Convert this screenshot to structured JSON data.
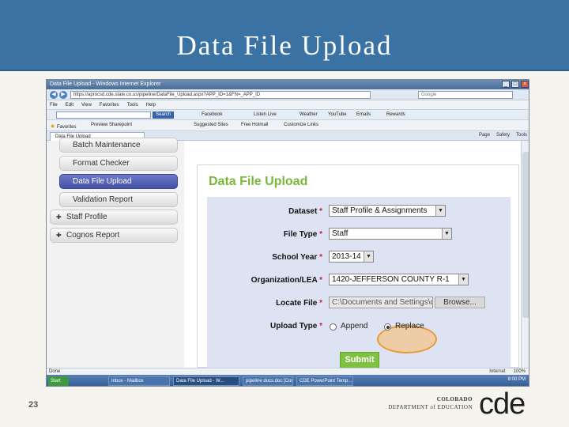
{
  "slide": {
    "title": "Data File Upload",
    "page_number": "23",
    "logo": {
      "line1": "COLORADO",
      "line2": "DEPARTMENT of EDUCATION",
      "mark": "cde"
    }
  },
  "browser": {
    "window_title": "Data File Upload - Windows Internet Explorer",
    "url": "https://aprocsd.cde.state.co.us/pipeline/DataFile_Upload.aspx?APP_ID=1&FN=_APP_ID",
    "search_placeholder": "Google",
    "menu": [
      "File",
      "Edit",
      "View",
      "Favorites",
      "Tools",
      "Help"
    ],
    "toolbar": {
      "search_button": "Search",
      "items": [
        "Facebook",
        "Listen Live",
        "Weather",
        "YouTube",
        "Emails",
        "Rewards"
      ]
    },
    "favorites": {
      "label": "Favorites",
      "items": [
        "Preview Sharepoint",
        "Suggested Sites",
        "Free Hotmail",
        "Customize Links"
      ]
    },
    "tab": "Data File Upload",
    "tab_tools": [
      "Page",
      "Safety",
      "Tools"
    ],
    "status": {
      "left": "Done",
      "zone": "Internet",
      "zoom": "100%"
    },
    "taskbar": {
      "start": "Start",
      "items": [
        "Inbox - Mailbox",
        "Data File Upload - W...",
        "pipeline docs.doc [Comp...",
        "CDE PowerPoint Temp..."
      ],
      "clock": "8:00 PM"
    }
  },
  "sidebar": {
    "items": [
      "Batch Maintenance",
      "Format Checker",
      "Data File Upload",
      "Validation Report"
    ],
    "groups": [
      "Staff Profile",
      "Cognos Report"
    ]
  },
  "form": {
    "title": "Data File Upload",
    "required_marker": "*",
    "dataset": {
      "label": "Dataset",
      "value": "Staff Profile & Assignments"
    },
    "file_type": {
      "label": "File Type",
      "value": "Staff"
    },
    "school_year": {
      "label": "School Year",
      "value": "2013-14"
    },
    "organization": {
      "label": "Organization/LEA",
      "value": "1420-JEFFERSON COUNTY R-1"
    },
    "locate_file": {
      "label": "Locate File",
      "value": "C:\\Documents and Settings\\c",
      "browse": "Browse..."
    },
    "upload_type": {
      "label": "Upload Type",
      "options": [
        "Append",
        "Replace"
      ],
      "selected": "Replace"
    },
    "submit": "Submit"
  }
}
